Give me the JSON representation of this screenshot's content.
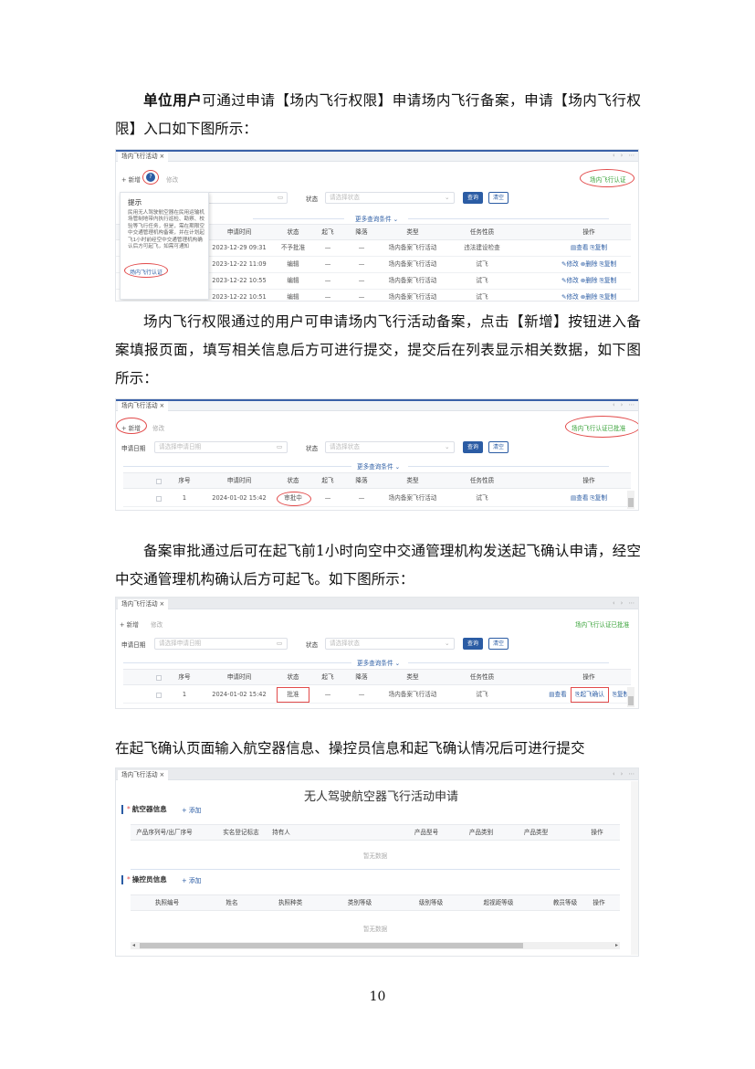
{
  "intro": {
    "bold": "单位用户",
    "text": "可通过申请【场内飞行权限】申请场内飞行备案，申请【场内飞行权限】入口如下图所示："
  },
  "para2": "场内飞行权限通过的用户可申请场内飞行活动备案，点击【新增】按钮进入备案填报页面，填写相关信息后方可进行提交，提交后在列表显示相关数据，如下图所示：",
  "para3": "备案审批通过后可在起飞前1小时向空中交通管理机构发送起飞确认申请，经空中交通管理机构确认后方可起飞。如下图所示：",
  "para4": "在起飞确认页面输入航空器信息、操控员信息和起飞确认情况后可进行提交",
  "page_number": "10",
  "common": {
    "tab": "场内飞行活动 ×",
    "tab_nav": "‹ › ⋯",
    "new": "+ 新增",
    "edit": "修改",
    "apply_date": "申请日期",
    "date_placeholder": "请选择申请日期",
    "status": "状态",
    "status_placeholder": "请选择状态",
    "query": "查询",
    "clear": "清空",
    "more": "更多查询条件 ⌄",
    "columns": [
      "序号",
      "申请时间",
      "状态",
      "起飞",
      "降落",
      "类型",
      "任务性质",
      "操作"
    ]
  },
  "shot1": {
    "right_link": "场内飞行认证",
    "popup": {
      "title": "提示",
      "body": "民用无人驾驶航空器在民用运输机场管制地带内执行巡检、勘察、校验等飞行任务，但是，需在期限空中交通管理机构备案，并在计划起飞1小时前经空中交通管理机构确认后方可起飞，如需可通知",
      "link": "场内飞行认证"
    },
    "rows": [
      {
        "no": "1",
        "time": "2023-12-29 09:31",
        "status": "不予批准",
        "takeoff": "—",
        "land": "—",
        "type": "场内备案飞行活动",
        "task": "违法建设检查",
        "ops": "▤查看  ⎘复制"
      },
      {
        "no": "2",
        "time": "2023-12-22 11:09",
        "status": "编辑",
        "takeoff": "—",
        "land": "—",
        "type": "场内备案飞行活动",
        "task": "试飞",
        "ops": "✎修改 ⊗删除 ⎘复制"
      },
      {
        "no": "3",
        "time": "2023-12-22 10:55",
        "status": "编辑",
        "takeoff": "—",
        "land": "—",
        "type": "场内备案飞行活动",
        "task": "试飞",
        "ops": "✎修改 ⊗删除 ⎘复制"
      },
      {
        "no": "4",
        "time": "2023-12-22 10:51",
        "status": "编辑",
        "takeoff": "—",
        "land": "—",
        "type": "场内备案飞行活动",
        "task": "试飞",
        "ops": "✎修改 ⊗删除 ⎘复制"
      }
    ]
  },
  "shot2": {
    "right_link": "场内飞行认证已批准",
    "row": {
      "no": "1",
      "time": "2024-01-02 15:42",
      "status": "审批中",
      "takeoff": "—",
      "land": "—",
      "type": "场内备案飞行活动",
      "task": "试飞",
      "ops": "▤查看  ⎘复制"
    }
  },
  "shot3": {
    "right_link": "场内飞行认证已批准",
    "row": {
      "no": "1",
      "time": "2024-01-02 15:42",
      "status": "批准",
      "takeoff": "—",
      "land": "—",
      "type": "场内备案飞行活动",
      "task": "试飞",
      "op_view": "▤查看",
      "op_confirm": "⎘起飞确认",
      "op_copy": "⎘复制"
    }
  },
  "shot4": {
    "title": "无人驾驶航空器飞行活动申请",
    "aircraft_section": "航空器信息",
    "operator_section": "操控员信息",
    "add": "+ 添加",
    "aircraft_columns": [
      "产品序列号/出厂序号",
      "实名登记标志",
      "持有人",
      "产品型号",
      "产品类别",
      "产品类型",
      "操作"
    ],
    "operator_columns": [
      "执照编号",
      "姓名",
      "执照种类",
      "类别等级",
      "级别等级",
      "超视距等级",
      "教员等级",
      "操作"
    ],
    "no_data": "暂无数据"
  }
}
